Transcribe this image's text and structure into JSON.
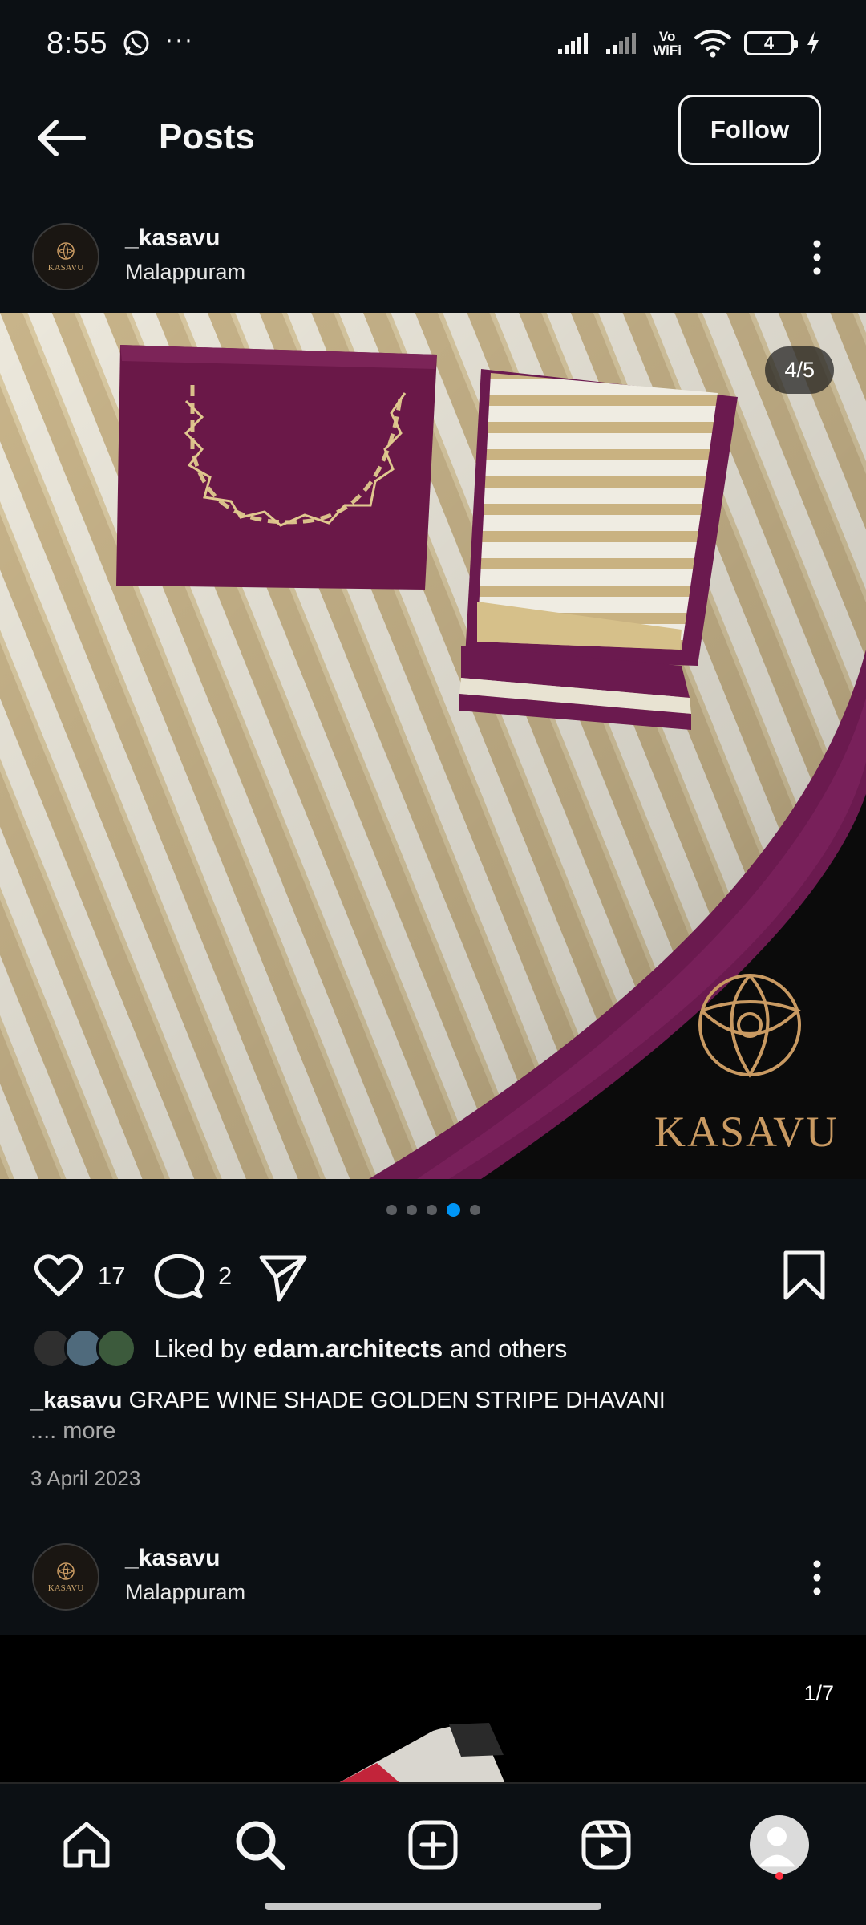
{
  "status_bar": {
    "time": "8:55",
    "more": "···",
    "vowifi_top": "Vo",
    "vowifi_bottom": "WiFi",
    "battery": "4"
  },
  "header": {
    "title": "Posts",
    "follow_label": "Follow"
  },
  "post1": {
    "username": "_kasavu",
    "location": "Malappuram",
    "image_counter": "4/5",
    "brand_watermark": "KASAVU",
    "avatar_text": "KASAVU",
    "carousel": {
      "count": 5,
      "active_index": 3
    },
    "likes_count": "17",
    "comments_count": "2",
    "liked_by_prefix": "Liked by",
    "liked_by_user": "edam.architects",
    "liked_by_suffix": "and others",
    "caption_user": "_kasavu",
    "caption_text": "GRAPE WINE SHADE GOLDEN STRIPE DHAVANI",
    "more_label": ".... more",
    "date": "3 April 2023"
  },
  "post2": {
    "username": "_kasavu",
    "location": "Malappuram",
    "avatar_text": "KASAVU",
    "image_counter": "1/7"
  },
  "colors": {
    "background": "#0c1014",
    "accent_blue": "#0095f6",
    "plum": "#6b1a4f",
    "gold": "#c99a62",
    "notification": "#ff3040"
  },
  "icons": {
    "back": "arrow-left-icon",
    "like": "heart-icon",
    "comment": "comment-icon",
    "share": "paper-plane-icon",
    "save": "bookmark-icon",
    "home": "home-icon",
    "search": "search-icon",
    "create": "plus-square-icon",
    "reels": "reels-icon",
    "profile": "profile-avatar"
  }
}
